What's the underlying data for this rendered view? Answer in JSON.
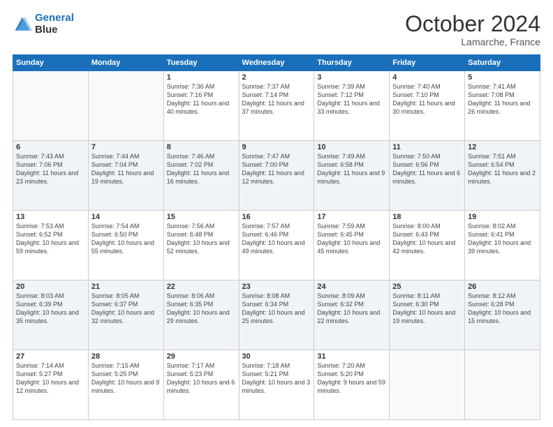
{
  "header": {
    "logo_line1": "General",
    "logo_line2": "Blue",
    "month": "October 2024",
    "location": "Lamarche, France"
  },
  "weekdays": [
    "Sunday",
    "Monday",
    "Tuesday",
    "Wednesday",
    "Thursday",
    "Friday",
    "Saturday"
  ],
  "weeks": [
    [
      {
        "day": "",
        "info": ""
      },
      {
        "day": "",
        "info": ""
      },
      {
        "day": "1",
        "info": "Sunrise: 7:36 AM\nSunset: 7:16 PM\nDaylight: 11 hours and 40 minutes."
      },
      {
        "day": "2",
        "info": "Sunrise: 7:37 AM\nSunset: 7:14 PM\nDaylight: 11 hours and 37 minutes."
      },
      {
        "day": "3",
        "info": "Sunrise: 7:39 AM\nSunset: 7:12 PM\nDaylight: 11 hours and 33 minutes."
      },
      {
        "day": "4",
        "info": "Sunrise: 7:40 AM\nSunset: 7:10 PM\nDaylight: 11 hours and 30 minutes."
      },
      {
        "day": "5",
        "info": "Sunrise: 7:41 AM\nSunset: 7:08 PM\nDaylight: 11 hours and 26 minutes."
      }
    ],
    [
      {
        "day": "6",
        "info": "Sunrise: 7:43 AM\nSunset: 7:06 PM\nDaylight: 11 hours and 23 minutes."
      },
      {
        "day": "7",
        "info": "Sunrise: 7:44 AM\nSunset: 7:04 PM\nDaylight: 11 hours and 19 minutes."
      },
      {
        "day": "8",
        "info": "Sunrise: 7:46 AM\nSunset: 7:02 PM\nDaylight: 11 hours and 16 minutes."
      },
      {
        "day": "9",
        "info": "Sunrise: 7:47 AM\nSunset: 7:00 PM\nDaylight: 11 hours and 12 minutes."
      },
      {
        "day": "10",
        "info": "Sunrise: 7:49 AM\nSunset: 6:58 PM\nDaylight: 11 hours and 9 minutes."
      },
      {
        "day": "11",
        "info": "Sunrise: 7:50 AM\nSunset: 6:56 PM\nDaylight: 11 hours and 6 minutes."
      },
      {
        "day": "12",
        "info": "Sunrise: 7:51 AM\nSunset: 6:54 PM\nDaylight: 11 hours and 2 minutes."
      }
    ],
    [
      {
        "day": "13",
        "info": "Sunrise: 7:53 AM\nSunset: 6:52 PM\nDaylight: 10 hours and 59 minutes."
      },
      {
        "day": "14",
        "info": "Sunrise: 7:54 AM\nSunset: 6:50 PM\nDaylight: 10 hours and 55 minutes."
      },
      {
        "day": "15",
        "info": "Sunrise: 7:56 AM\nSunset: 6:48 PM\nDaylight: 10 hours and 52 minutes."
      },
      {
        "day": "16",
        "info": "Sunrise: 7:57 AM\nSunset: 6:46 PM\nDaylight: 10 hours and 49 minutes."
      },
      {
        "day": "17",
        "info": "Sunrise: 7:59 AM\nSunset: 6:45 PM\nDaylight: 10 hours and 45 minutes."
      },
      {
        "day": "18",
        "info": "Sunrise: 8:00 AM\nSunset: 6:43 PM\nDaylight: 10 hours and 42 minutes."
      },
      {
        "day": "19",
        "info": "Sunrise: 8:02 AM\nSunset: 6:41 PM\nDaylight: 10 hours and 39 minutes."
      }
    ],
    [
      {
        "day": "20",
        "info": "Sunrise: 8:03 AM\nSunset: 6:39 PM\nDaylight: 10 hours and 35 minutes."
      },
      {
        "day": "21",
        "info": "Sunrise: 8:05 AM\nSunset: 6:37 PM\nDaylight: 10 hours and 32 minutes."
      },
      {
        "day": "22",
        "info": "Sunrise: 8:06 AM\nSunset: 6:35 PM\nDaylight: 10 hours and 29 minutes."
      },
      {
        "day": "23",
        "info": "Sunrise: 8:08 AM\nSunset: 6:34 PM\nDaylight: 10 hours and 25 minutes."
      },
      {
        "day": "24",
        "info": "Sunrise: 8:09 AM\nSunset: 6:32 PM\nDaylight: 10 hours and 22 minutes."
      },
      {
        "day": "25",
        "info": "Sunrise: 8:11 AM\nSunset: 6:30 PM\nDaylight: 10 hours and 19 minutes."
      },
      {
        "day": "26",
        "info": "Sunrise: 8:12 AM\nSunset: 6:28 PM\nDaylight: 10 hours and 15 minutes."
      }
    ],
    [
      {
        "day": "27",
        "info": "Sunrise: 7:14 AM\nSunset: 5:27 PM\nDaylight: 10 hours and 12 minutes."
      },
      {
        "day": "28",
        "info": "Sunrise: 7:15 AM\nSunset: 5:25 PM\nDaylight: 10 hours and 9 minutes."
      },
      {
        "day": "29",
        "info": "Sunrise: 7:17 AM\nSunset: 5:23 PM\nDaylight: 10 hours and 6 minutes."
      },
      {
        "day": "30",
        "info": "Sunrise: 7:18 AM\nSunset: 5:21 PM\nDaylight: 10 hours and 3 minutes."
      },
      {
        "day": "31",
        "info": "Sunrise: 7:20 AM\nSunset: 5:20 PM\nDaylight: 9 hours and 59 minutes."
      },
      {
        "day": "",
        "info": ""
      },
      {
        "day": "",
        "info": ""
      }
    ]
  ]
}
